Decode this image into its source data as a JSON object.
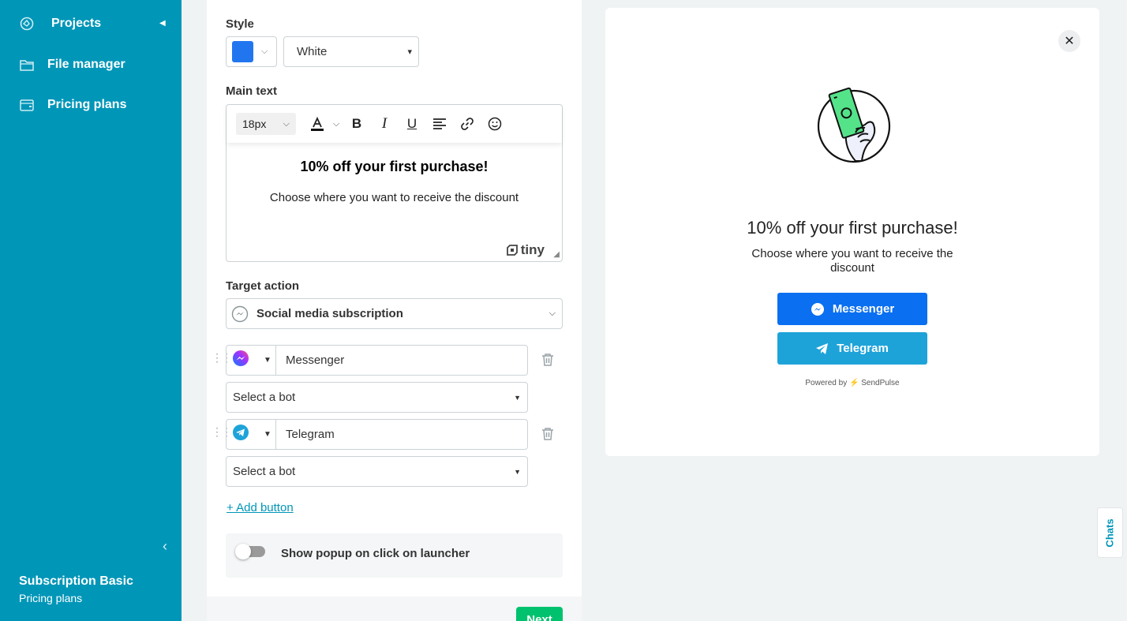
{
  "sidebar": {
    "items": [
      {
        "label": "Projects",
        "icon": "projects-icon"
      },
      {
        "label": "File manager",
        "icon": "folder-icon"
      },
      {
        "label": "Pricing plans",
        "icon": "wallet-icon"
      }
    ],
    "footer_title": "Subscription Basic",
    "footer_subtitle": "Pricing plans"
  },
  "editor": {
    "style_label": "Style",
    "style_color": "#2176f0",
    "style_theme": "White",
    "main_text_label": "Main text",
    "font_size": "18px",
    "content_heading": "10% off your first purchase!",
    "content_text": "Choose where you want to receive the discount",
    "tiny_brand": "tiny",
    "target_action_label": "Target action",
    "target_action_value": "Social media subscription",
    "buttons": [
      {
        "name": "Messenger",
        "icon": "messenger-icon",
        "bot_placeholder": "Select a bot"
      },
      {
        "name": "Telegram",
        "icon": "telegram-icon",
        "bot_placeholder": "Select a bot"
      }
    ],
    "add_button_label": "+ Add button",
    "toggle_label": "Show popup on click on launcher",
    "toggle_on": false,
    "next_label": "Next"
  },
  "preview": {
    "title": "10% off your first purchase!",
    "text": "Choose where you want to receive the discount",
    "buttons": [
      {
        "label": "Messenger",
        "color": "#0a6ff0"
      },
      {
        "label": "Telegram",
        "color": "#1ea3d9"
      }
    ],
    "powered_prefix": "Powered by",
    "powered_brand": "SendPulse"
  },
  "chats_tab_label": "Chats",
  "colors": {
    "sidebar": "#0096b8",
    "accent_green": "#00c26e"
  }
}
